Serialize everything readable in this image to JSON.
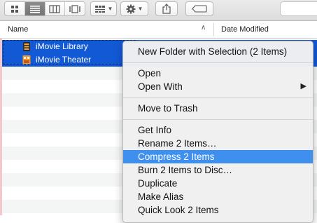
{
  "toolbar": {
    "view_modes": [
      {
        "name": "icon-view",
        "icon": "grid-icon",
        "active": false
      },
      {
        "name": "list-view",
        "icon": "list-icon",
        "active": true
      },
      {
        "name": "column-view",
        "icon": "columns-icon",
        "active": false
      },
      {
        "name": "gallery-view",
        "icon": "coverflow-icon",
        "active": false
      }
    ],
    "arrange_icon": "arrange-grid-icon",
    "action_icon": "gear-icon",
    "share_icon": "share-icon",
    "tags_icon": "tag-icon"
  },
  "columns": {
    "name": "Name",
    "date_modified": "Date Modified"
  },
  "files": [
    {
      "name": "iMovie Library",
      "icon": "imovie-library-icon",
      "selected": true
    },
    {
      "name": "iMovie Theater",
      "icon": "imovie-theater-icon",
      "selected": true
    }
  ],
  "context_menu": {
    "items": [
      {
        "label": "New Folder with Selection (2 Items)"
      },
      {
        "label": "Open"
      },
      {
        "label": "Open With",
        "submenu": true,
        "submenu_arrow": "▶"
      },
      {
        "label": "Move to Trash"
      },
      {
        "label": "Get Info"
      },
      {
        "label": "Rename 2 Items…"
      },
      {
        "label": "Compress 2 Items",
        "highlighted": true
      },
      {
        "label": "Burn 2 Items to Disc…"
      },
      {
        "label": "Duplicate"
      },
      {
        "label": "Make Alias"
      },
      {
        "label": "Quick Look 2 Items"
      }
    ]
  },
  "colors": {
    "selection": "#1259d6",
    "menu_highlight": "#3f8fee"
  }
}
